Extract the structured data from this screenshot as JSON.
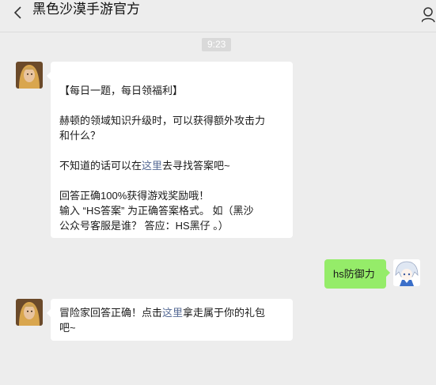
{
  "header": {
    "title": "黑色沙漠手游官方"
  },
  "chat": {
    "timestamp": "9:23",
    "msg1": {
      "line1": "【每日一题，每日领福利】",
      "line2": "赫顿的领域知识升级时，可以获得额外攻击力",
      "line3": "和什么？",
      "line4_pre": "不知道的话可以在",
      "line4_link": "这里",
      "line4_post": "去寻找答案吧~",
      "line5": "回答正确100%获得游戏奖励哦！",
      "line6": "输入 “HS答案” 为正确答案格式。 如（黑沙",
      "line7": "公众号客服是谁？ 答应：HS黑仔 。）"
    },
    "msg2": {
      "text": "hs防御力"
    },
    "msg3": {
      "line1_pre": "冒险家回答正确！点击",
      "line1_link": "这里",
      "line1_post": "拿走属于你的礼包",
      "line2": "吧~"
    }
  },
  "colors": {
    "background": "#ededed",
    "bubble_left": "#ffffff",
    "bubble_right": "#95ec69",
    "link": "#576b95"
  },
  "icons": {
    "back": "chevron-left-icon",
    "profile": "person-icon"
  }
}
